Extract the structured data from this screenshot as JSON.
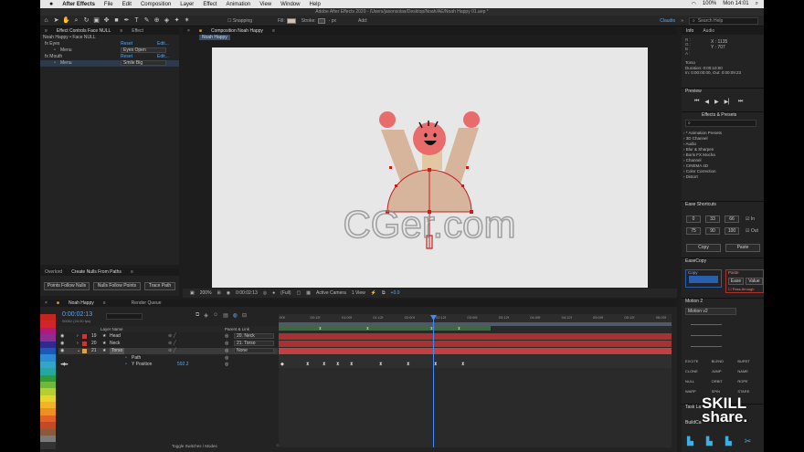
{
  "menubar": {
    "app_name": "After Effects",
    "items": [
      "File",
      "Edit",
      "Composition",
      "Layer",
      "Effect",
      "Animation",
      "View",
      "Window",
      "Help"
    ],
    "status": {
      "battery": "100%",
      "clock": "Mon 14:01"
    }
  },
  "window_title": "Adobe After Effects 2020 - /Users/jasonsolas/Desktop/Noah/AE/Noah Happy 01.aep *",
  "toolbar": {
    "snapping": "Snapping",
    "fill_label": "Fill:",
    "stroke_label": "Stroke:",
    "stroke_width": "- px",
    "add_label": "Add:",
    "workspace": "Claudio",
    "search_placeholder": "Search Help"
  },
  "effect_controls": {
    "tab_label": "Effect Controls Face NULL",
    "tab2": "Effect",
    "header": "Noah Happy • Face NULL",
    "rows": [
      {
        "name": "fx  Eyes",
        "reset": "Reset",
        "edit": "Edit..."
      },
      {
        "name": "Menu",
        "value": "Eyes Open"
      },
      {
        "name": "fx  Mouth",
        "reset": "Reset",
        "edit": "Edit..."
      },
      {
        "name": "Menu",
        "value": "Smile Big"
      }
    ]
  },
  "composition": {
    "tab_label": "Composition Noah Happy",
    "breadcrumb": "Noah Happy",
    "zoom": "200%",
    "timecode": "0:00:02:13",
    "resolution": "(Full)",
    "camera": "Active Camera",
    "views": "1 View",
    "exposure": "+0.0"
  },
  "watermark": "CGer.com",
  "null_tool": {
    "tabs": [
      "Overlord",
      "Create Nulls From Paths"
    ],
    "buttons": [
      "Points Follow Nulls",
      "Nulls Follow Points",
      "Trace Path"
    ]
  },
  "info_panel": {
    "tabs": [
      "Info",
      "Audio"
    ],
    "coords": {
      "x": "X : 1135",
      "y": "Y : 707"
    },
    "layer": "Torso",
    "duration": "Duration: 0:00:10:00",
    "in_out": "In: 0:00:00:00, Out: 0:00:09:23"
  },
  "preview": {
    "title": "Preview"
  },
  "effects_presets": {
    "title": "Effects & Presets",
    "items": [
      "* Animation Presets",
      "3D Channel",
      "Audio",
      "Blur & Sharpen",
      "Boris FX Mocha",
      "Channel",
      "CINEMA 4D",
      "Color Correction",
      "Distort"
    ]
  },
  "ease_shortcuts": {
    "title": "Ease Shortcuts",
    "row1": [
      "0",
      "33",
      "66"
    ],
    "row2": [
      "75",
      "90",
      "100"
    ],
    "in_label": "In",
    "out_label": "Out",
    "copy": "Copy",
    "paste": "Paste"
  },
  "easecopy": {
    "title": "EaseCopy",
    "copy": "Copy",
    "paste": "Paste",
    "ease": "Ease",
    "value": "Value",
    "pass_through": "Pass-through"
  },
  "motion": {
    "title": "Motion 2",
    "preset": "Motion v2",
    "tools": [
      "EXCITE",
      "BLEND",
      "BURST",
      "CLONE",
      "JUMP",
      "NAME",
      "NULL",
      "ORBIT",
      "ROPE",
      "WARP",
      "SPIN",
      "STARE"
    ],
    "task_label": "Task La",
    "build_label": "BuildCa"
  },
  "branding": {
    "line1": "SKILL",
    "line2": "share."
  },
  "timeline": {
    "tabs": [
      "Noah Happy",
      "Render Queue"
    ],
    "timecode": "0:00:02:13",
    "frames": "00061 (24.00 fps)",
    "col_layer_name": "Layer Name",
    "col_parent": "Parent & Link",
    "ruler": [
      ":00f",
      "00:12f",
      "01:00f",
      "01:12f",
      "02:00f",
      "02:12f",
      "03:00f",
      "03:12f",
      "04:00f",
      "04:12f",
      "05:00f",
      "05:12f",
      "06:00f"
    ],
    "layers": [
      {
        "num": "19",
        "name": "Head",
        "parent": "20. Neck",
        "color": "#c23b3b"
      },
      {
        "num": "20",
        "name": "Neck",
        "parent": "21. Torso",
        "color": "#c23b3b"
      },
      {
        "num": "21",
        "name": "Torso",
        "parent": "None",
        "color": "#d9a34a"
      }
    ],
    "subrows": [
      {
        "name": "Path"
      },
      {
        "name": "Y Position",
        "value": "592.2"
      }
    ],
    "toggle_label": "Toggle Switches / Modes"
  },
  "palette": [
    "#c4251c",
    "#d0262b",
    "#b1197b",
    "#8e2c8f",
    "#2f2a8f",
    "#1c58b5",
    "#2d8bd6",
    "#33a6c6",
    "#26a79b",
    "#2f9b3a",
    "#71b83a",
    "#b8cd30",
    "#e8d52c",
    "#f0b428",
    "#ee8e23",
    "#e65f26",
    "#c24a24",
    "#8a5a3c",
    "#7a7a7a",
    "#333333"
  ]
}
